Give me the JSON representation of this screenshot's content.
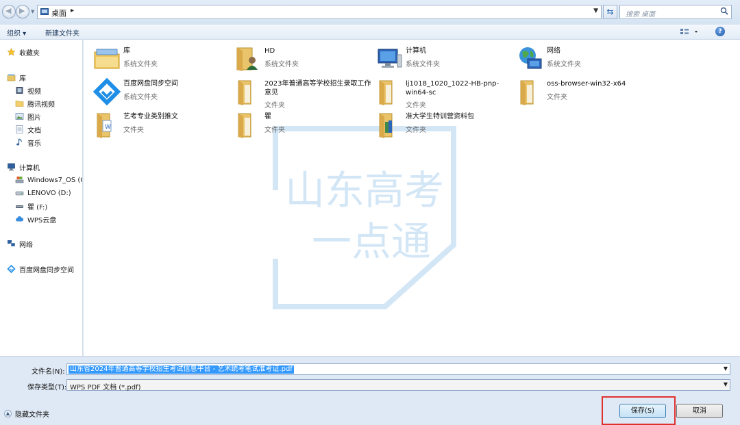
{
  "address": {
    "crumb": "桌面",
    "search_placeholder": "搜索 桌面"
  },
  "toolbar": {
    "organize": "组织 ▾",
    "new_folder": "新建文件夹"
  },
  "nav": {
    "favorites": "收藏夹",
    "libraries": "库",
    "videos": "视频",
    "tencent_video": "腾讯视频",
    "pictures": "图片",
    "documents": "文档",
    "music": "音乐",
    "computer": "计算机",
    "drive_c": "Windows7_OS (C:",
    "drive_d": "LENOVO (D:)",
    "drive_f": "瞿 (F:)",
    "wps_cloud": "WPS云盘",
    "network": "网络",
    "baidu_sync": "百度网盘同步空间"
  },
  "items": [
    {
      "name": "库",
      "type": "系统文件夹"
    },
    {
      "name": "HD",
      "type": "系统文件夹"
    },
    {
      "name": "计算机",
      "type": "系统文件夹"
    },
    {
      "name": "网络",
      "type": "系统文件夹"
    },
    {
      "name": "百度网盘同步空间",
      "type": "系统文件夹"
    },
    {
      "name": "2023年普通高等学校招生录取工作意见",
      "type": "文件夹"
    },
    {
      "name": "lj1018_1020_1022-HB-pnp-win64-sc",
      "type": "文件夹"
    },
    {
      "name": "oss-browser-win32-x64",
      "type": "文件夹"
    },
    {
      "name": "艺考专业类别推文",
      "type": "文件夹"
    },
    {
      "name": "瞿",
      "type": "文件夹"
    },
    {
      "name": "准大学生特训营资料包",
      "type": "文件夹"
    }
  ],
  "watermark": {
    "line1": "山东高考",
    "line2": "一点通"
  },
  "bottom": {
    "filename_label": "文件名(N):",
    "filename_value": "山东省2024年普通高等学校招生考试信息平台 - 艺术统考笔试准考证.pdf",
    "filetype_label": "保存类型(T):",
    "filetype_value": "WPS PDF 文档 (*.pdf)",
    "hide_folders": "隐藏文件夹",
    "save": "保存(S)",
    "cancel": "取消"
  }
}
